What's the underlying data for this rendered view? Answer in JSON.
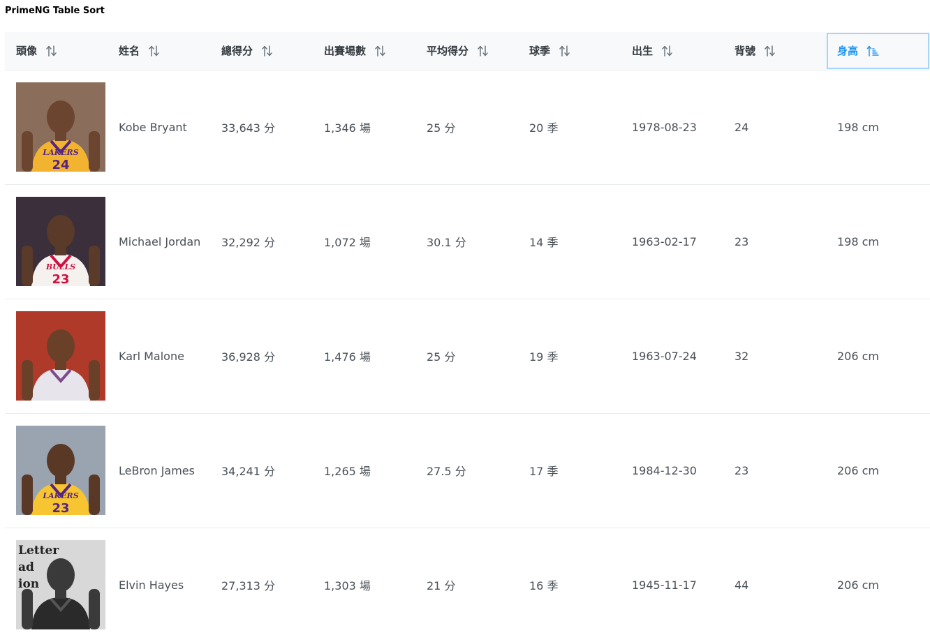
{
  "page": {
    "title": "PrimeNG Table Sort"
  },
  "colors": {
    "header_bg": "#f8f9fa",
    "sorted_header_text": "#2196f3",
    "sorted_header_outline": "#a6d5fa",
    "row_border": "#e9ecef",
    "cell_text": "#495057"
  },
  "table": {
    "columns": [
      {
        "label": "頭像",
        "sort_icon": "sort-alt-icon",
        "sorted": false
      },
      {
        "label": "姓名",
        "sort_icon": "sort-alt-icon",
        "sorted": false
      },
      {
        "label": "總得分",
        "sort_icon": "sort-alt-icon",
        "sorted": false
      },
      {
        "label": "出賽場數",
        "sort_icon": "sort-alt-icon",
        "sorted": false
      },
      {
        "label": "平均得分",
        "sort_icon": "sort-alt-icon",
        "sorted": false
      },
      {
        "label": "球季",
        "sort_icon": "sort-alt-icon",
        "sorted": false
      },
      {
        "label": "出生",
        "sort_icon": "sort-alt-icon",
        "sorted": false
      },
      {
        "label": "背號",
        "sort_icon": "sort-alt-icon",
        "sorted": false
      },
      {
        "label": "身高",
        "sort_icon": "sort-amount-up-icon",
        "sorted": true
      }
    ],
    "rows": [
      {
        "avatar": {
          "jersey_text": "LAKERS",
          "number": "24",
          "jersey_color": "#f2b430",
          "trim_color": "#552583",
          "bg_color": "#8a6d5a",
          "skin_color": "#6b4530"
        },
        "name": "Kobe Bryant",
        "points": "33,643 分",
        "games": "1,346 場",
        "avg": "25 分",
        "seasons": "20 季",
        "birth": "1978-08-23",
        "number": "24",
        "height": "198 cm"
      },
      {
        "avatar": {
          "jersey_text": "BULLS",
          "number": "23",
          "jersey_color": "#f4f1ee",
          "trim_color": "#ce1141",
          "bg_color": "#3a2f3a",
          "skin_color": "#5a3a28"
        },
        "name": "Michael Jordan",
        "points": "32,292 分",
        "games": "1,072 場",
        "avg": "30.1 分",
        "seasons": "14 季",
        "birth": "1963-02-17",
        "number": "23",
        "height": "198 cm"
      },
      {
        "avatar": {
          "jersey_text": "",
          "number": "",
          "jersey_color": "#e8e4ec",
          "trim_color": "#7a4a8a",
          "bg_color": "#b03a2a",
          "skin_color": "#6a4028"
        },
        "name": "Karl Malone",
        "points": "36,928 分",
        "games": "1,476 場",
        "avg": "25 分",
        "seasons": "19 季",
        "birth": "1963-07-24",
        "number": "32",
        "height": "206 cm"
      },
      {
        "avatar": {
          "jersey_text": "LAKERS",
          "number": "23",
          "jersey_color": "#f7c531",
          "trim_color": "#552583",
          "bg_color": "#9aa4b0",
          "skin_color": "#5a3826"
        },
        "name": "LeBron James",
        "points": "34,241 分",
        "games": "1,265 場",
        "avg": "27.5 分",
        "seasons": "17 季",
        "birth": "1984-12-30",
        "number": "23",
        "height": "206 cm"
      },
      {
        "avatar": {
          "jersey_text": "",
          "number": "",
          "jersey_color": "#2a2a2a",
          "trim_color": "#555555",
          "bg_color": "#d8d8d8",
          "skin_color": "#3a3a3a",
          "sign_text": "Letter\nad\nion"
        },
        "name": "Elvin Hayes",
        "points": "27,313 分",
        "games": "1,303 場",
        "avg": "21 分",
        "seasons": "16 季",
        "birth": "1945-11-17",
        "number": "44",
        "height": "206 cm"
      }
    ]
  }
}
